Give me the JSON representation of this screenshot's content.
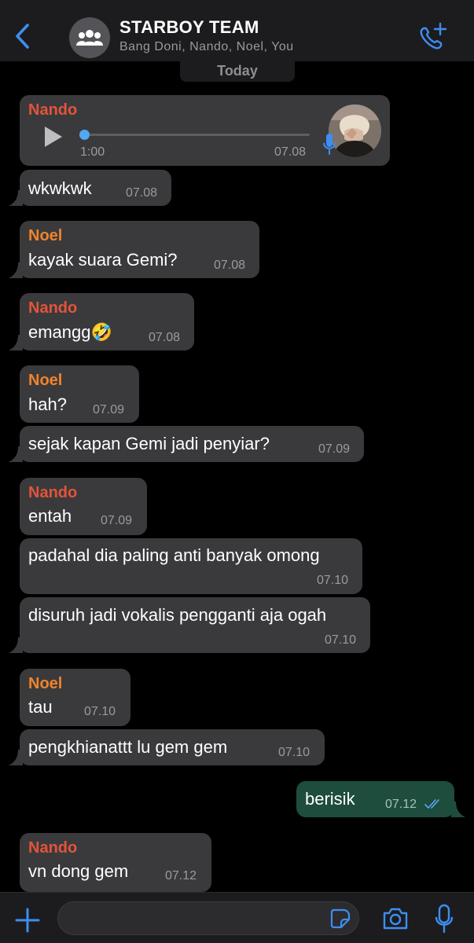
{
  "header": {
    "title": "STARBOY TEAM",
    "subtitle": "Bang Doni, Nando, Noel, You",
    "back_icon": "chevron-left-icon",
    "avatar_icon": "group-icon",
    "call_icon": "phone-plus-icon"
  },
  "day_separator": "Today",
  "voice_message": {
    "sender": "Nando",
    "duration": "1:00",
    "time": "07.08",
    "progress_fraction": 0.0
  },
  "messages": [
    {
      "text": "wkwkwk",
      "time": "07.08"
    },
    {
      "sender": "Noel",
      "text": "kayak suara Gemi?",
      "time": "07.08"
    },
    {
      "sender": "Nando",
      "text": "emangg🤣",
      "time": "07.08"
    },
    {
      "sender": "Noel",
      "text": "hah?",
      "time": "07.09"
    },
    {
      "text": "sejak kapan Gemi jadi penyiar?",
      "time": "07.09"
    },
    {
      "sender": "Nando",
      "text": "entah",
      "time": "07.09"
    },
    {
      "text": "padahal dia paling anti banyak omong",
      "time": "07.10"
    },
    {
      "text": "disuruh jadi vokalis pengganti aja ogah",
      "time": "07.10"
    },
    {
      "sender": "Noel",
      "text": "tau",
      "time": "07.10"
    },
    {
      "text": "pengkhianattt lu gem gem",
      "time": "07.10"
    },
    {
      "text": "berisik",
      "time": "07.12",
      "outgoing": true,
      "status": "read"
    },
    {
      "sender": "Nando",
      "text": "vn dong gem",
      "time": "07.12"
    }
  ],
  "input": {
    "placeholder": "",
    "value": ""
  },
  "colors": {
    "background": "#000000",
    "bar": "#1c1c1e",
    "incoming_bubble": "#3a3a3c",
    "outgoing_bubble": "#1e4d3d",
    "accent": "#3d8ef0",
    "noel": "#f0832c",
    "nando": "#e4533a"
  }
}
